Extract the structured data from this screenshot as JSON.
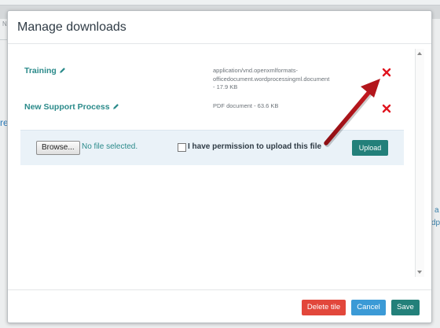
{
  "background": {
    "frag_top": "Ni",
    "frag_left": "re",
    "frag_right_a": "a",
    "frag_right_b": "dpi"
  },
  "modal": {
    "title": "Manage downloads"
  },
  "downloads": [
    {
      "name": "Training",
      "meta_lines": [
        "application/vnd.openxmlformats-",
        "officedocument.wordprocessingml.document",
        "- 17.9 KB"
      ],
      "remove_icon": "red-x-icon"
    },
    {
      "name": "New Support Process",
      "meta_lines": [
        "PDF document - 63.6 KB"
      ],
      "remove_icon": "red-x-icon"
    }
  ],
  "upload": {
    "browse_label": "Browse...",
    "no_file_text": "No file selected.",
    "permission_label": "I have permission to upload this file",
    "permission_checked": false,
    "upload_label": "Upload"
  },
  "footer": {
    "delete_label": "Delete tile",
    "cancel_label": "Cancel",
    "save_label": "Save"
  },
  "colors": {
    "accent_teal": "#23807a",
    "danger_red": "#e2473b",
    "cancel_blue": "#3b9ad6",
    "remove_x_red": "#e0141e",
    "annotation_arrow": "#a8141a"
  }
}
